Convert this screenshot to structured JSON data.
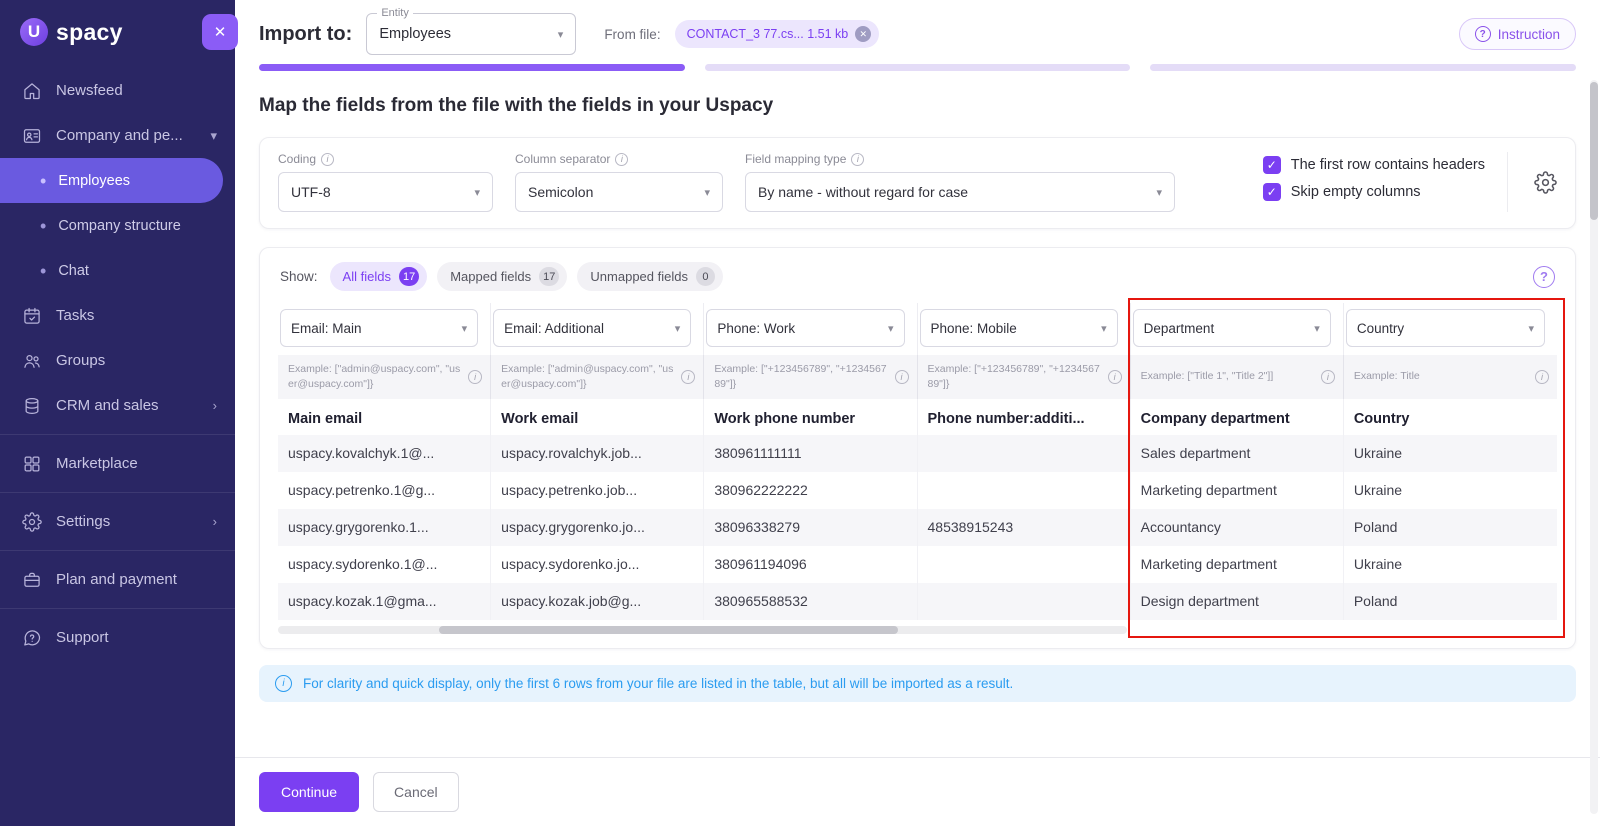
{
  "icons": {
    "close": "✕",
    "question": "?",
    "info": "i",
    "check": "✓",
    "chevron_down": "▾",
    "chevron_right": "›",
    "bullet": "•"
  },
  "colors": {
    "accent": "#7b3ff2",
    "sidebar_bg": "#2a2664",
    "red_highlight": "#e5170f",
    "info_blue": "#2b9cf0",
    "progress_active": "#8b5cf6"
  },
  "sidebar": {
    "logo_badge": "U",
    "logo_text": "spacy",
    "items": [
      {
        "label": "Newsfeed"
      },
      {
        "label": "Company and pe..."
      },
      {
        "label": "Employees"
      },
      {
        "label": "Company structure"
      },
      {
        "label": "Chat"
      },
      {
        "label": "Tasks"
      },
      {
        "label": "Groups"
      },
      {
        "label": "CRM and sales"
      },
      {
        "label": "Marketplace"
      },
      {
        "label": "Settings"
      },
      {
        "label": "Plan and payment"
      },
      {
        "label": "Support"
      }
    ]
  },
  "header": {
    "title": "Import to:",
    "entity": {
      "label": "Entity",
      "value": "Employees"
    },
    "from_file_label": "From file:",
    "file_chip": "CONTACT_3 77.cs... 1.51 kb",
    "instruction": "Instruction"
  },
  "content": {
    "heading": "Map the fields from the file with the fields in your Uspacy",
    "settings": {
      "coding": {
        "label": "Coding",
        "value": "UTF-8"
      },
      "separator": {
        "label": "Column separator",
        "value": "Semicolon"
      },
      "mapping_type": {
        "label": "Field mapping type",
        "value": "By name - without regard for case"
      },
      "checkbox_headers": "The first row contains headers",
      "checkbox_skip": "Skip empty columns"
    },
    "filters": {
      "show_label": "Show:",
      "all": {
        "label": "All fields",
        "count": "17"
      },
      "mapped": {
        "label": "Mapped fields",
        "count": "17"
      },
      "unmapped": {
        "label": "Unmapped fields",
        "count": "0"
      }
    },
    "table": {
      "mappings": [
        "Email: Main",
        "Email: Additional",
        "Phone: Work",
        "Phone: Mobile",
        "Department",
        "Country"
      ],
      "examples": [
        "Example: [\"admin@uspacy.com\", \"user@uspacy.com\"]}",
        "Example: [\"admin@uspacy.com\", \"user@uspacy.com\"]}",
        "Example: [\"+123456789\", \"+123456789\"]}",
        "Example: [\"+123456789\", \"+123456789\"]}",
        "Example: [\"Title 1\", \"Title 2\"]]",
        "Example: Title"
      ],
      "headers": [
        "Main email",
        "Work email",
        "Work phone number",
        "Phone number:additi...",
        "Company department",
        "Country"
      ],
      "rows": [
        [
          "uspacy.kovalchyk.1@...",
          "uspacy.rovalchyk.job...",
          "380961111111",
          "",
          "Sales department",
          "Ukraine"
        ],
        [
          "uspacy.petrenko.1@g...",
          "uspacy.petrenko.job...",
          "380962222222",
          "",
          "Marketing department",
          "Ukraine"
        ],
        [
          "uspacy.grygorenko.1...",
          "uspacy.grygorenko.jo...",
          "38096338279",
          "48538915243",
          "Accountancy",
          "Poland"
        ],
        [
          "uspacy.sydorenko.1@...",
          "uspacy.sydorenko.jo...",
          "380961194096",
          "",
          "Marketing department",
          "Ukraine"
        ],
        [
          "uspacy.kozak.1@gma...",
          "uspacy.kozak.job@g...",
          "380965588532",
          "",
          "Design department",
          "Poland"
        ]
      ]
    },
    "info_banner": "For clarity and quick display, only the first 6 rows from your file are listed in the table, but all will be imported as a result.",
    "buttons": {
      "continue": "Continue",
      "cancel": "Cancel"
    }
  }
}
